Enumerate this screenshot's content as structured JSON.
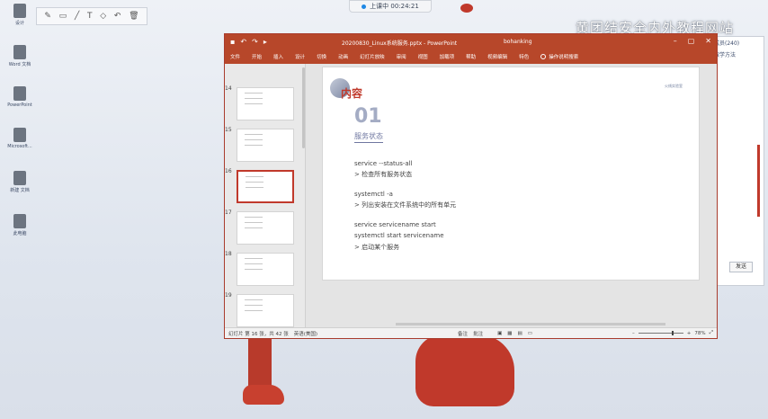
{
  "desktop": {
    "icons": [
      {
        "label": "设计"
      },
      {
        "label": "Word 文档"
      },
      {
        "label": "PowerPoint"
      },
      {
        "label": "Microsoft..."
      },
      {
        "label": "新建 文档"
      },
      {
        "label": "此电脑"
      }
    ],
    "watermark": "黄团结安全内外教程网站"
  },
  "recording": {
    "label": "上课中 00:24:21"
  },
  "annotation_toolbar": {
    "tools": [
      "pen-icon",
      "rectangle-icon",
      "line-icon",
      "text-icon",
      "eraser-icon",
      "undo-icon",
      "delete-icon"
    ]
  },
  "side_window": {
    "lines": [
      "成员(240)",
      "教学方法",
      "",
      ""
    ],
    "send_label": "发送"
  },
  "powerpoint": {
    "file_title": "20200830_Linux系统服务.pptx - PowerPoint",
    "user": "bohanking",
    "ribbon_tabs": [
      "文件",
      "开始",
      "插入",
      "设计",
      "切换",
      "动画",
      "幻灯片放映",
      "审阅",
      "视图",
      "加载项",
      "帮助",
      "视频编辑",
      "特色"
    ],
    "tell_me": "操作说明搜索",
    "thumbnails": [
      {
        "num": "14"
      },
      {
        "num": "15"
      },
      {
        "num": "16",
        "selected": true
      },
      {
        "num": "17"
      },
      {
        "num": "18"
      },
      {
        "num": "19"
      }
    ],
    "slide": {
      "heading": "内容",
      "logo_text": "火线实验室",
      "section_number": "01",
      "section_title": "服务状态",
      "lines": [
        {
          "cmd": "service --status-all",
          "desc": "> 检查所有服务状态"
        },
        {
          "cmd": "systemctl -a",
          "desc": "> 列出安装在文件系统中的所有单元"
        },
        {
          "cmd": "service servicename start",
          "cmd2": "systemctl start servicename",
          "desc": "> 启动某个服务"
        }
      ]
    },
    "status": {
      "slide_info": "幻灯片 第 16 张，共 42 张",
      "language": "英语(美国)",
      "notes": "备注",
      "comments": "批注",
      "zoom": "78%",
      "zoom_level": 0.78
    }
  },
  "colors": {
    "accent": "#b7472a",
    "selection": "#c0392b",
    "heading": "#c0392b"
  }
}
